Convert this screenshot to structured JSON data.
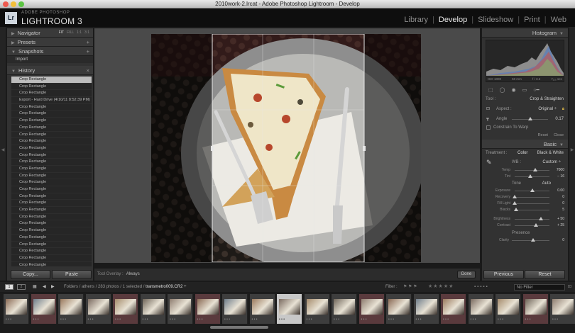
{
  "window": {
    "title": "2010work-2.lrcat - Adobe Photoshop Lightroom - Develop"
  },
  "identity": {
    "logo": "Lr",
    "subtitle": "ADOBE PHOTOSHOP",
    "name": "LIGHTROOM 3"
  },
  "modules": [
    {
      "label": "Library",
      "active": false
    },
    {
      "label": "Develop",
      "active": true
    },
    {
      "label": "Slideshow",
      "active": false
    },
    {
      "label": "Print",
      "active": false
    },
    {
      "label": "Web",
      "active": false
    }
  ],
  "left_panel": {
    "navigator": {
      "label": "Navigator",
      "modes": [
        "FIT",
        "FILL",
        "1:1",
        "3:1"
      ]
    },
    "presets": {
      "label": "Presets"
    },
    "snapshots": {
      "label": "Snapshots",
      "items": [
        "Import"
      ]
    },
    "history": {
      "label": "History",
      "items": [
        "Crop Rectangle",
        "Crop Rectangle",
        "Crop Rectangle",
        "Export - Hard Drive (4/10/11 8:52:39 PM)",
        "Crop Rectangle",
        "Crop Rectangle",
        "Crop Rectangle",
        "Crop Rectangle",
        "Crop Rectangle",
        "Crop Rectangle",
        "Crop Rectangle",
        "Crop Rectangle",
        "Crop Rectangle",
        "Crop Rectangle",
        "Crop Rectangle",
        "Crop Rectangle",
        "Crop Rectangle",
        "Crop Rectangle",
        "Crop Rectangle",
        "Crop Rectangle",
        "Crop Rectangle",
        "Crop Rectangle",
        "Crop Rectangle",
        "Crop Rectangle",
        "Crop Rectangle",
        "Crop Rectangle",
        "Crop Rectangle",
        "Crop Rectangle"
      ]
    },
    "copy_label": "Copy...",
    "paste_label": "Paste"
  },
  "toolbar": {
    "overlay_label": "Tool Overlay :",
    "overlay_value": "Always",
    "done_label": "Done"
  },
  "right_panel": {
    "histogram": {
      "label": "Histogram",
      "iso": "ISO 1000",
      "focal": "50 mm",
      "aperture": "f / 3.2",
      "shutter": "¹⁄₁₂₅ sec"
    },
    "crop": {
      "tool_label": "Tool :",
      "tool_value": "Crop & Straighten",
      "aspect_label": "Aspect :",
      "aspect_value": "Original ÷",
      "angle_label": "Angle",
      "angle_value": "0.17",
      "angle_level": 0.51,
      "constrain_label": "Constrain To Warp",
      "reset_label": "Reset",
      "close_label": "Close"
    },
    "basic": {
      "label": "Basic",
      "treatment_label": "Treatment :",
      "color_label": "Color",
      "bw_label": "Black & White",
      "wb_label": "WB :",
      "wb_value": "Custom ÷",
      "sliders_wb": [
        {
          "label": "Temp",
          "value": "7000",
          "level": 0.6
        },
        {
          "label": "Tint",
          "value": "− 16",
          "level": 0.45
        }
      ],
      "tone_label": "Tone",
      "auto_label": "Auto",
      "sliders_tone": [
        {
          "label": "Exposure",
          "value": "0.00",
          "level": 0.5
        },
        {
          "label": "Recovery",
          "value": "0",
          "level": 0.0
        },
        {
          "label": "Fill Light",
          "value": "0",
          "level": 0.0
        },
        {
          "label": "Blacks",
          "value": "5",
          "level": 0.05
        }
      ],
      "sliders_presence": [
        {
          "label": "Brightness",
          "value": "+ 50",
          "level": 0.75
        },
        {
          "label": "Contrast",
          "value": "+ 25",
          "level": 0.62
        }
      ],
      "presence_label": "Presence",
      "clarity_label": "Clarity",
      "clarity_value": "0"
    },
    "previous_label": "Previous",
    "reset_label": "Reset"
  },
  "filmstrip_bar": {
    "page1": "1",
    "page2": "2",
    "crumb_prefix": "Folders / athens / 283 photos / 1 selected / ",
    "crumb_file": "transmetro009.CR2 ÷",
    "filter_label": "Filter :",
    "stars": "★★★★★",
    "filter_value": "No Filter"
  },
  "filmstrip": {
    "count": 21,
    "selected_index": 10,
    "colors": {
      "accent_selected": "#c8c8c8",
      "pink_tint": "#5a3a3d"
    }
  }
}
